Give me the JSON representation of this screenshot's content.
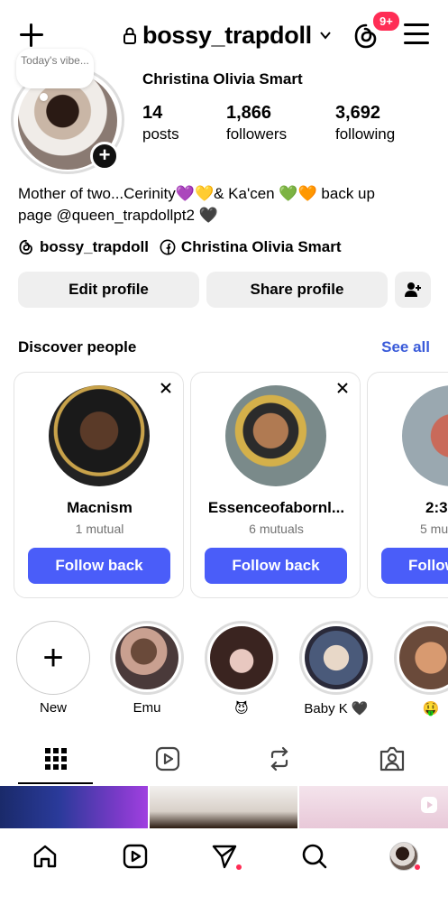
{
  "header": {
    "username": "bossy_trapdoll",
    "threads_badge": "9+"
  },
  "profile": {
    "note": "Today's vibe...",
    "full_name": "Christina Olivia Smart",
    "stats": [
      {
        "value": "14",
        "label": "posts"
      },
      {
        "value": "1,866",
        "label": "followers"
      },
      {
        "value": "3,692",
        "label": "following"
      }
    ],
    "bio_line1": "Mother of two...Cerinity💜💛& Ka'cen 💚🧡 back up",
    "bio_line2": "page @queen_trapdollpt2 🖤",
    "threads_link": "bossy_trapdoll",
    "facebook_link": "Christina Olivia Smart"
  },
  "buttons": {
    "edit": "Edit profile",
    "share": "Share profile"
  },
  "discover": {
    "title": "Discover people",
    "see_all": "See all",
    "cards": [
      {
        "name": "Macnism",
        "mutual": "1 mutual",
        "button": "Follow back"
      },
      {
        "name": "Essenceofabornl...",
        "mutual": "6 mutuals",
        "button": "Follow back"
      },
      {
        "name": "2:3",
        "mutual": "5 mu",
        "button": "Follow"
      }
    ]
  },
  "highlights": [
    {
      "label": "New"
    },
    {
      "label": "Emu"
    },
    {
      "label": "😈"
    },
    {
      "label": "Baby K 🖤"
    },
    {
      "label": "🤑"
    }
  ],
  "colors": {
    "accent": "#4a5df9",
    "link": "#3a5bd9",
    "badge": "#ff2d55",
    "button_bg": "#efefef"
  }
}
